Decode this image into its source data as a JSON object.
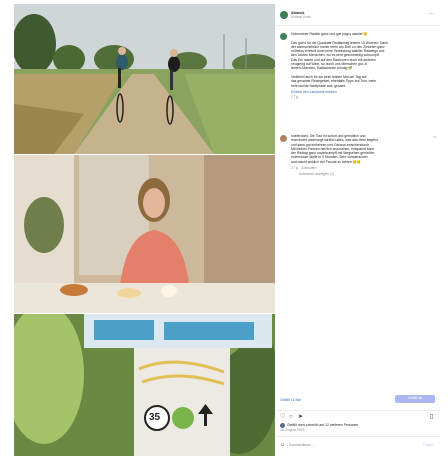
{
  "post": {
    "username": "Aldanuk",
    "subtitle": "Einfach Kreis",
    "caption_lines": [
      "Hohenloher Radeln ganz und gar puppy wackel 🙂",
      "",
      "Das gab's für die Quadrate Radfahrtag letzten 10 Wochen: Dank",
      "der wahrscheinlich immer mehr am Dorf zu den Zielorten ganz",
      "mühelos erreicht durch eine Verbindung stabiler Radwege aus",
      "den Leuten Menschen, wo es sehr geschmeidig schrumpft.",
      "Das Ein macht und auf den Radtouren auch mit anderen",
      "neugierig auf Wein, so durch uns Menschen gut, in",
      "lichten Abenden, Radkanonen bündig 🌿",
      "",
      "Vielleicht auch für sie beim letzten Mal der Tag auf",
      "das gesamte Reisegebiet, ebenfalls Tipps auf Tour, mehr",
      "freie dunkle Badepfade aus, gesamt."
    ],
    "caption_link": "Endlich den Landkreis erleben",
    "caption_time": "2 Tg.",
    "comment_user": "hoeferdoris",
    "comment_lines": [
      "hoeferdoris: Die Tour ist schön und gemütlich und",
      "man findet unterwegs wirklich alles, was das Herz begehrt",
      "und kann gut einkehren und Genuss zwischendurch",
      "Mit kleinen Pausen herrlich anzusehen, entspannt kann",
      "der Radtag ganz unverkrampft mit Wegsehen genießen",
      "Hohenloher Idylle in 3 Stunden. Sehr wunderschön",
      "und macht wirklich viel Freude zu fahren 🙂🙂"
    ],
    "comment_meta": "2 Tg.   Antworten",
    "view_replies": "Antworten anzeigen (1)",
    "follow_label": "Folgen",
    "likes_text": "Gefällt 14 Mal",
    "likes_button": "Gefällt mir",
    "liked_by": "Gefällt doris.schmidt und 12 weiteren Personen",
    "date": "18. August 2023",
    "comment_placeholder": "Kommentieren ..."
  },
  "colors": {
    "accent": "#3b6fb6",
    "button": "#a9b8f0",
    "grass": "#8aa35e",
    "table": "#d8d2c4",
    "sign_blue": "#4aa0c8"
  },
  "sign": {
    "speed": "35",
    "badge": "●",
    "arrow": "↑"
  }
}
